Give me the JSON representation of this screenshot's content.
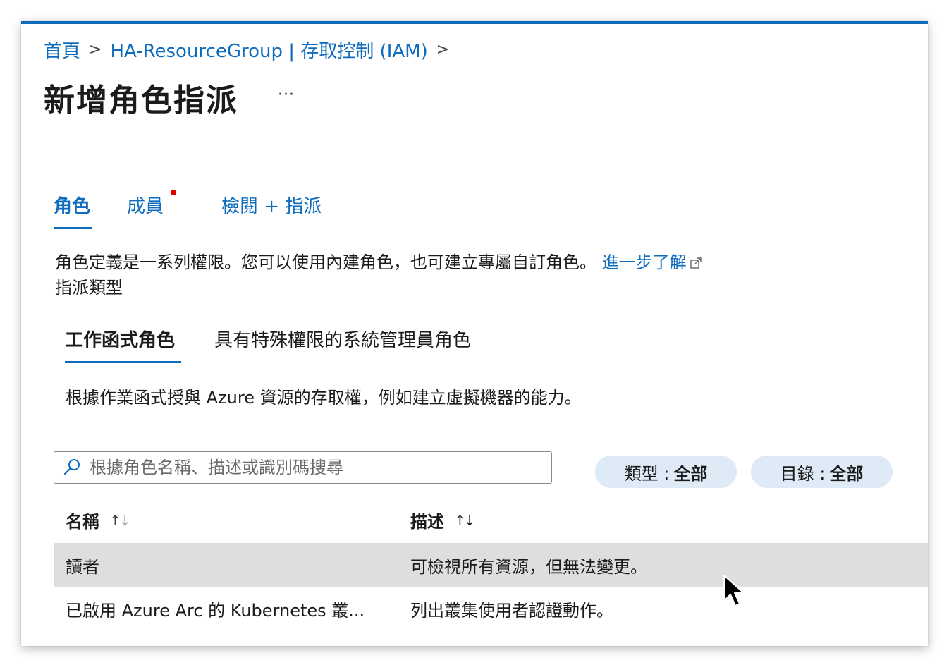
{
  "breadcrumb": {
    "home": "首頁",
    "resource": "HA-ResourceGroup | 存取控制 (IAM)"
  },
  "page_title": "新增角色指派",
  "more_label": "···",
  "tabs": [
    {
      "label": "角色",
      "active": true
    },
    {
      "label": "成員",
      "active": false,
      "has_error_dot": true
    },
    {
      "label": "檢閱 + 指派",
      "active": false
    }
  ],
  "description": "角色定義是一系列權限。您可以使用內建角色，也可建立專屬自訂角色。",
  "learn_more": "進一步了解",
  "assignment_type_label": "指派類型",
  "sub_tabs": [
    {
      "label": "工作函式角色",
      "active": true
    },
    {
      "label": "具有特殊權限的系統管理員角色",
      "active": false
    }
  ],
  "sub_description": "根據作業函式授與 Azure 資源的存取權，例如建立虛擬機器的能力。",
  "search": {
    "placeholder": "根據角色名稱、描述或識別碼搜尋",
    "value": ""
  },
  "filters": [
    {
      "label": "類型 :",
      "value": "全部"
    },
    {
      "label": "目錄 :",
      "value": "全部"
    }
  ],
  "table": {
    "columns": [
      "名稱",
      "描述"
    ],
    "rows": [
      {
        "name": "讀者",
        "description": "可檢視所有資源，但無法變更。",
        "selected": true
      },
      {
        "name": "已啟用 Azure Arc 的 Kubernetes 叢...",
        "description": "列出叢集使用者認證動作。",
        "selected": false
      }
    ]
  },
  "colors": {
    "accent": "#0f6cbd",
    "error_dot": "#e00000",
    "pill_bg": "#deebf7",
    "selected_row": "#dedede"
  }
}
